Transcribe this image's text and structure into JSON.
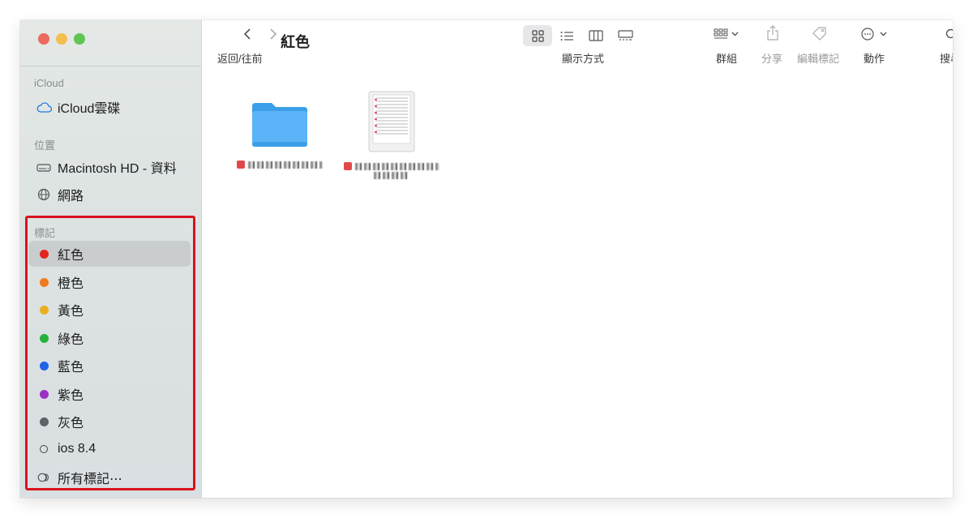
{
  "window": {
    "title": "紅色"
  },
  "traffic_lights": {
    "close": "#ed6a5e",
    "minimize": "#f5bf4f",
    "zoom": "#61c554"
  },
  "sidebar": {
    "sections": [
      {
        "label": "iCloud",
        "items": [
          {
            "label": "iCloud雲碟",
            "icon": "cloud-icon"
          }
        ]
      },
      {
        "label": "位置",
        "items": [
          {
            "label": "Macintosh HD - 資料",
            "icon": "hard-drive-icon"
          },
          {
            "label": "網路",
            "icon": "globe-icon"
          }
        ]
      },
      {
        "label": "標記",
        "items": [
          {
            "label": "紅色",
            "color": "#e5231f",
            "selected": true
          },
          {
            "label": "橙色",
            "color": "#f17a1f"
          },
          {
            "label": "黃色",
            "color": "#e8b021"
          },
          {
            "label": "綠色",
            "color": "#26b23d"
          },
          {
            "label": "藍色",
            "color": "#1f63e7"
          },
          {
            "label": "紫色",
            "color": "#9b2fc2"
          },
          {
            "label": "灰色",
            "color": "#5f6368"
          },
          {
            "label": "ios 8.4",
            "icon": "empty-tag-icon"
          },
          {
            "label": "所有標記⋯",
            "icon": "all-tags-icon"
          }
        ]
      }
    ],
    "highlight_color": "#d9131e"
  },
  "toolbar": {
    "back_forward_label": "返回/往前",
    "view_label": "顯示方式",
    "group_label": "群組",
    "share_label": "分享",
    "edit_tags_label": "編輯標記",
    "action_label": "動作",
    "search_label": "搜尋"
  },
  "files": [
    {
      "kind": "folder",
      "tag_color": "#e0484a"
    },
    {
      "kind": "document",
      "tag_color": "#e0484a"
    }
  ]
}
